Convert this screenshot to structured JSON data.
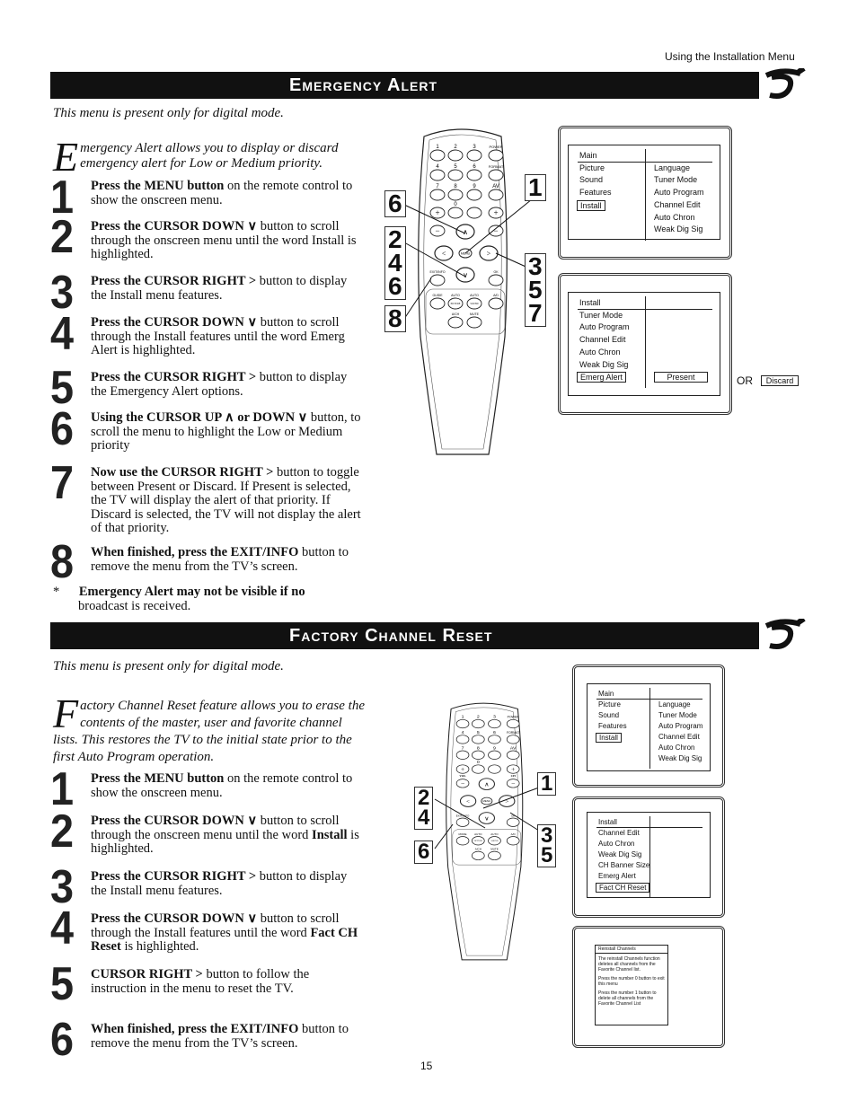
{
  "running_header": "Using the Installation Menu",
  "page_number": "15",
  "emergency": {
    "title": "Emergency Alert",
    "note": "This menu is present only for digital mode.",
    "intro_cap": "E",
    "intro": "mergency Alert allows you to display or discard emergency alert for Low or Medium priority.",
    "steps": [
      {
        "n": "1",
        "bold": "Press the MENU button",
        "text": " on the remote control to show the onscreen menu."
      },
      {
        "n": "2",
        "bold": "Press the CURSOR DOWN ∨",
        "text": " button to scroll through the onscreen menu until the word Install is highlighted."
      },
      {
        "n": "3",
        "bold": "Press the CURSOR RIGHT >",
        "text": " button to display the Install menu features."
      },
      {
        "n": "4",
        "bold": "Press the CURSOR DOWN ∨",
        "text": " button to scroll through the Install features until the word Emerg Alert is highlighted."
      },
      {
        "n": "5",
        "bold": "Press the CURSOR RIGHT >",
        "text": " button to display the Emergency Alert options."
      },
      {
        "n": "6",
        "bold": "Using the  CURSOR  UP ∧  or DOWN ∨",
        "text": " button, to scroll the menu to highlight the Low or Medium priority"
      },
      {
        "n": "7",
        "bold": "Now use the CURSOR RIGHT >",
        "text": " button to toggle between Present or Discard.  If Present is selected, the TV will display the alert of that priority.  If Discard is selected,  the TV will not display the alert of that priority."
      },
      {
        "n": "8",
        "bold": "When finished, press the EXIT/INFO",
        "text": " button to remove the menu from the TV’s screen."
      }
    ],
    "footnote_mark": "*",
    "footnote_bold": "Emergency Alert may not be visible if no",
    "footnote_text": "broadcast is received.",
    "screen1": {
      "header": "Main",
      "left": [
        "Picture",
        "Sound",
        "Features",
        "Install"
      ],
      "right": [
        "Language",
        "Tuner Mode",
        "Auto Program",
        "Channel Edit",
        "Auto Chron",
        "Weak Dig Sig"
      ]
    },
    "screen2": {
      "header": "Install",
      "left": [
        "Tuner Mode",
        "Auto Program",
        "Channel Edit",
        "Auto Chron",
        "Weak Dig Sig",
        "Emerg Alert"
      ],
      "value": "Present",
      "or": "OR",
      "alt": "Discard"
    },
    "callouts": {
      "a": "6",
      "b": [
        "2",
        "4",
        "6"
      ],
      "c": "8",
      "d": "1",
      "e": [
        "3",
        "5",
        "7"
      ]
    }
  },
  "factory": {
    "title": "Factory Channel Reset",
    "note": "This menu is present only for digital mode.",
    "intro_cap": "F",
    "intro": "actory Channel Reset feature allows you to erase the contents of the master, user and favorite channel lists.  This restores the TV to the initial state prior to the first Auto Program operation.",
    "steps": [
      {
        "n": "1",
        "bold": "Press the MENU button",
        "text": " on the remote control to show the onscreen menu."
      },
      {
        "n": "2",
        "bold": "Press the CURSOR DOWN ∨",
        "text": " button to scroll through the onscreen menu until the word ",
        "bold2": "Install",
        "text2": " is highlighted."
      },
      {
        "n": "3",
        "bold": "Press the CURSOR RIGHT >",
        "text": " button to display the Install menu features."
      },
      {
        "n": "4",
        "bold": "Press the CURSOR DOWN ∨",
        "text": " button to scroll through the Install features until the word ",
        "bold2": "Fact CH Reset",
        "text2": " is highlighted."
      },
      {
        "n": "5",
        "bold": "CURSOR RIGHT >",
        "text": " button to follow the instruction in the menu to reset the TV."
      },
      {
        "n": "6",
        "bold": "When finished, press the EXIT/INFO",
        "text": " button to remove the menu from the TV’s screen."
      }
    ],
    "screen1": {
      "header": "Main",
      "left": [
        "Picture",
        "Sound",
        "Features",
        "Install"
      ],
      "right": [
        "Language",
        "Tuner Mode",
        "Auto Program",
        "Channel Edit",
        "Auto Chron",
        "Weak Dig Sig"
      ]
    },
    "screen2": {
      "header": "Install",
      "left": [
        "Channel Edit",
        "Auto Chron",
        "Weak Dig Sig",
        "CH Banner Size",
        "Emerg Alert",
        "Fact CH Reset"
      ]
    },
    "screen3": {
      "title": "Reinstall Channels",
      "p1": "The reinstall Channels function deletes all channels from the Favorite Channel list.",
      "p2": "Press the number 0 button to exit this menu",
      "p3": "Press the number 1 button to delete all channels from the Favorite Channel List"
    },
    "callouts": {
      "a": "1",
      "b": [
        "2",
        "4"
      ],
      "c": "6",
      "d": [
        "3",
        "5"
      ]
    }
  },
  "remote": {
    "labels1": [
      "1",
      "2",
      "3",
      "POWER",
      "4",
      "5",
      "6",
      "FORMAT",
      "7",
      "8",
      "9",
      "AV",
      "0",
      "",
      "MENU",
      "EXIT/INFO",
      "OK",
      "GUIDE",
      "AUTO",
      "AUTO",
      "A/D",
      "A/CH",
      "MUTE",
      "PICTURE",
      "SOUND"
    ],
    "labels2": [
      "1",
      "2",
      "3",
      "POWER",
      "4",
      "5",
      "6",
      "FORMAT",
      "7",
      "8",
      "9",
      "AV",
      "0",
      "",
      "MENU",
      "EXIT/INFO",
      "OK",
      "MODE",
      "AUTO",
      "AUTO",
      "A/D",
      "A/CH",
      "MUTE",
      "PICTURE",
      "SOUND",
      "VOL",
      "CH"
    ]
  }
}
